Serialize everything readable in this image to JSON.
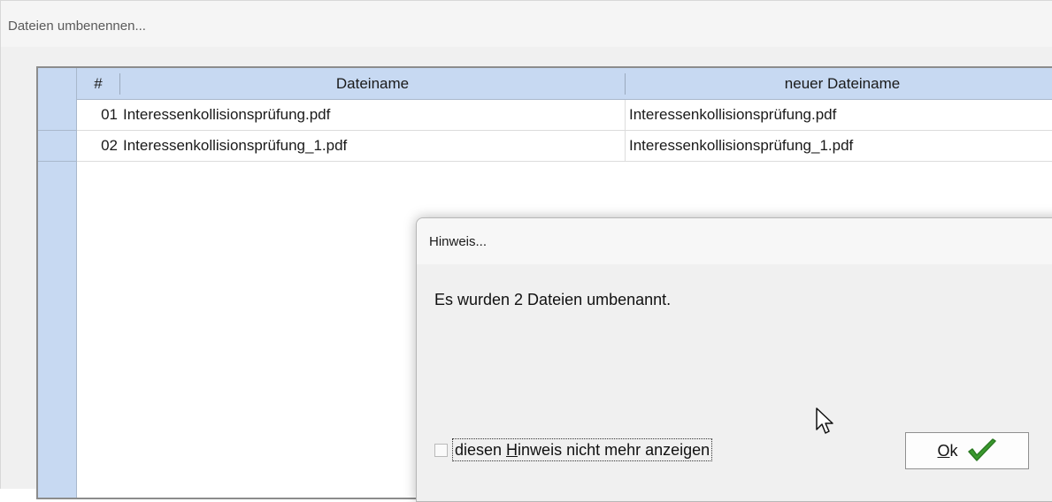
{
  "window": {
    "title": "Dateien umbenennen..."
  },
  "grid": {
    "columns": {
      "index": "#",
      "filename": "Dateiname",
      "new_filename": "neuer Dateiname"
    },
    "rows": [
      {
        "index": "01",
        "filename": "Interessenkollisionsprüfung.pdf",
        "new_filename": "Interessenkollisionsprüfung.pdf"
      },
      {
        "index": "02",
        "filename": "Interessenkollisionsprüfung_1.pdf",
        "new_filename": "Interessenkollisionsprüfung_1.pdf"
      }
    ]
  },
  "dialog": {
    "title": "Hinweis...",
    "message": "Es wurden 2 Dateien umbenannt.",
    "checkbox": {
      "label_pre": "diesen ",
      "label_accel": "H",
      "label_post": "inweis nicht mehr anzeigen",
      "checked": false
    },
    "ok_button": {
      "accel": "O",
      "rest": "k"
    }
  },
  "icons": {
    "ok": "checkmark-icon",
    "cursor": "mouse-cursor-icon"
  },
  "colors": {
    "grid_header": "#c7d9f2",
    "check_green": "#3a9a2e"
  }
}
